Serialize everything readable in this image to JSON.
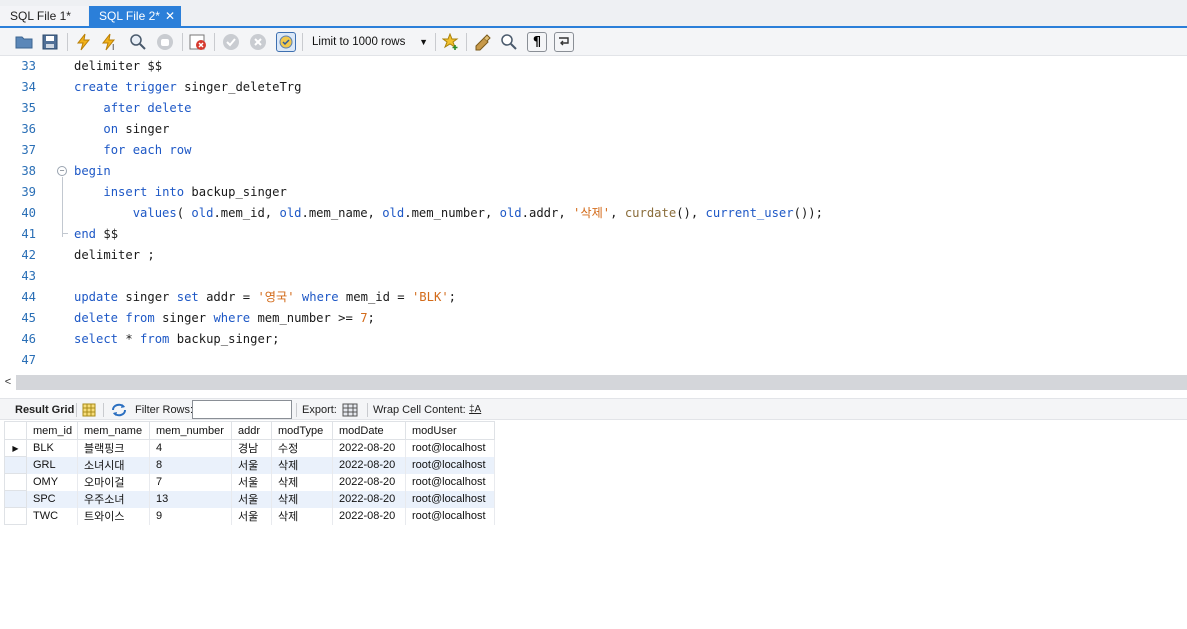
{
  "tabs": [
    {
      "label": "SQL File 1*",
      "active": false
    },
    {
      "label": "SQL File 2*",
      "active": true,
      "close": "✕"
    }
  ],
  "toolbar": {
    "limit_select": "Limit to 1000 rows",
    "icons": [
      "open-folder-icon",
      "save-icon",
      "execute-icon",
      "execute-current-icon",
      "explain-icon",
      "stop-icon",
      "toggle-error-icon",
      "commit-icon",
      "rollback-icon",
      "autocommit-icon",
      "limit-select",
      "bookmark-icon",
      "beautify-icon",
      "find-icon",
      "invisible-chars-icon",
      "wrap-icon"
    ]
  },
  "editor": {
    "lines": [
      {
        "n": "33",
        "code": "delimiter $$"
      },
      {
        "n": "34",
        "code": "create trigger singer_deleteTrg"
      },
      {
        "n": "35",
        "code": "    after delete"
      },
      {
        "n": "36",
        "code": "    on singer"
      },
      {
        "n": "37",
        "code": "    for each row"
      },
      {
        "n": "38",
        "code": "begin"
      },
      {
        "n": "39",
        "code": "    insert into backup_singer"
      },
      {
        "n": "40",
        "code": "        values( old.mem_id, old.mem_name, old.mem_number, old.addr, '삭제', curdate(), current_user());"
      },
      {
        "n": "41",
        "code": "end $$"
      },
      {
        "n": "42",
        "code": "delimiter ;"
      },
      {
        "n": "43",
        "code": ""
      },
      {
        "n": "44",
        "code": "update singer set addr = '영국' where mem_id = 'BLK';"
      },
      {
        "n": "45",
        "code": "delete from singer where mem_number >= 7;"
      },
      {
        "n": "46",
        "code": "select * from backup_singer;"
      },
      {
        "n": "47",
        "code": ""
      }
    ]
  },
  "scrollbar": {
    "left_arrow": "<"
  },
  "result_toolbar": {
    "result_grid": "Result Grid",
    "filter_rows": "Filter Rows:",
    "filter_value": "",
    "export": "Export:",
    "wrap_cell": "Wrap Cell Content:",
    "wrap_icon_text": "‡A"
  },
  "grid": {
    "columns": [
      "mem_id",
      "mem_name",
      "mem_number",
      "addr",
      "modType",
      "modDate",
      "modUser"
    ],
    "rows": [
      [
        "BLK",
        "블랙핑크",
        "4",
        "경남",
        "수정",
        "2022-08-20",
        "root@localhost"
      ],
      [
        "GRL",
        "소녀시대",
        "8",
        "서울",
        "삭제",
        "2022-08-20",
        "root@localhost"
      ],
      [
        "OMY",
        "오마이걸",
        "7",
        "서울",
        "삭제",
        "2022-08-20",
        "root@localhost"
      ],
      [
        "SPC",
        "우주소녀",
        "13",
        "서울",
        "삭제",
        "2022-08-20",
        "root@localhost"
      ],
      [
        "TWC",
        "트와이스",
        "9",
        "서울",
        "삭제",
        "2022-08-20",
        "root@localhost"
      ]
    ],
    "current_row_marker": "▶"
  },
  "colors": {
    "accent": "#2b7fd9",
    "keyword": "#1e58c6",
    "string": "#d36b1a",
    "alt_row": "#eaf1fb"
  }
}
